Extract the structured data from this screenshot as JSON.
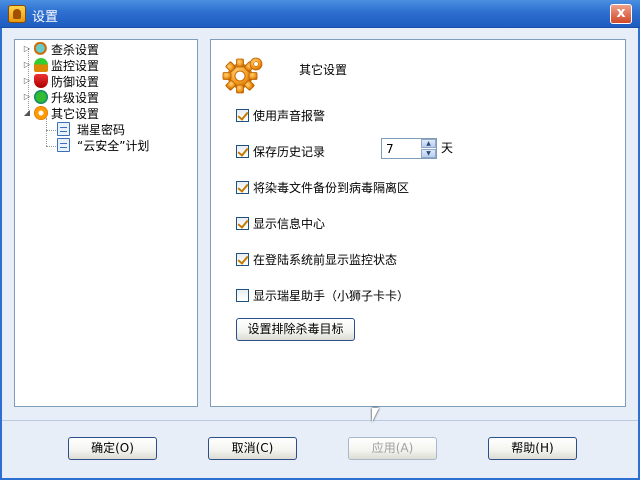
{
  "window": {
    "title": "设置",
    "close_label": "x"
  },
  "tree": {
    "items": [
      {
        "label": "查杀设置",
        "icon": "scan-icon",
        "expander": "▷"
      },
      {
        "label": "监控设置",
        "icon": "umbrella-icon",
        "expander": "▷"
      },
      {
        "label": "防御设置",
        "icon": "shield-icon",
        "expander": "▷"
      },
      {
        "label": "升级设置",
        "icon": "update-icon",
        "expander": "▷"
      },
      {
        "label": "其它设置",
        "icon": "gear-icon",
        "expander": "◢",
        "selected": true
      },
      {
        "label": "瑞星密码",
        "icon": "document-icon",
        "child": true
      },
      {
        "label": "“云安全”计划",
        "icon": "document-icon",
        "child": true
      }
    ]
  },
  "content": {
    "title": "其它设置",
    "options": [
      {
        "label": "使用声音报警",
        "checked": true
      },
      {
        "label": "保存历史记录",
        "checked": true
      },
      {
        "label": "将染毒文件备份到病毒隔离区",
        "checked": true
      },
      {
        "label": "显示信息中心",
        "checked": true
      },
      {
        "label": "在登陆系统前显示监控状态",
        "checked": true
      },
      {
        "label": "显示瑞星助手（小狮子卡卡）",
        "checked": false
      }
    ],
    "history_days": {
      "value": "7",
      "unit": "天"
    },
    "exclude_button": "设置排除杀毒目标"
  },
  "footer": {
    "ok": "确定(O)",
    "cancel": "取消(C)",
    "apply": "应用(A)",
    "help": "帮助(H)"
  }
}
